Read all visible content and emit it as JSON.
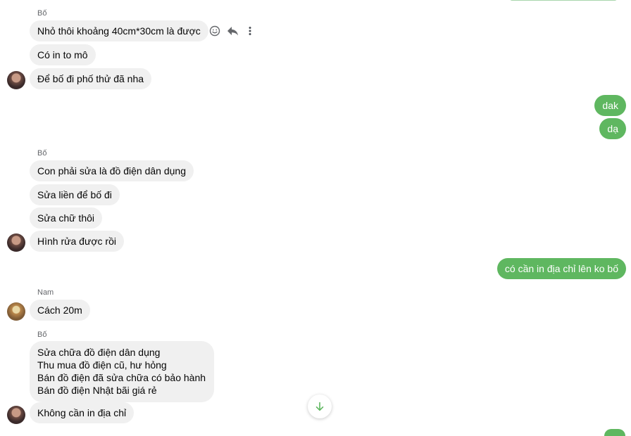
{
  "colors": {
    "incoming_bg": "#f0f0f0",
    "outgoing_bg": "#5fb760",
    "sender_text": "#65676b"
  },
  "icons": {
    "react": "smile-icon",
    "reply": "reply-icon",
    "more": "more-vertical-icon",
    "scroll": "arrow-down-icon"
  },
  "groups": [
    {
      "sender": "Bố",
      "messages": [
        "Nhỏ thôi khoảng 40cm*30cm là được",
        "Có in to mô",
        "Để bố đi phố thử đã nha"
      ]
    },
    {
      "outgoing": [
        "dak",
        "dạ"
      ]
    },
    {
      "sender": "Bố",
      "messages": [
        "Con phải sửa là đồ điện dân dụng",
        "Sửa liền để bố đi",
        "Sửa chữ thôi",
        "Hình rửa được rồi"
      ]
    },
    {
      "outgoing": [
        "có cần in địa chỉ lên ko bố"
      ]
    },
    {
      "sender": "Nam",
      "messages": [
        "Cách 20m"
      ]
    },
    {
      "sender": "Bố",
      "multiline": [
        "Sửa chữa đồ điện dân dụng",
        "Thu mua đồ điện cũ, hư hỏng",
        "Bán đồ điện đã sửa chữa có bảo hành",
        "Bán đồ điện Nhật bãi giá rẻ"
      ],
      "messages": [
        "Không cần in địa chỉ"
      ]
    }
  ]
}
